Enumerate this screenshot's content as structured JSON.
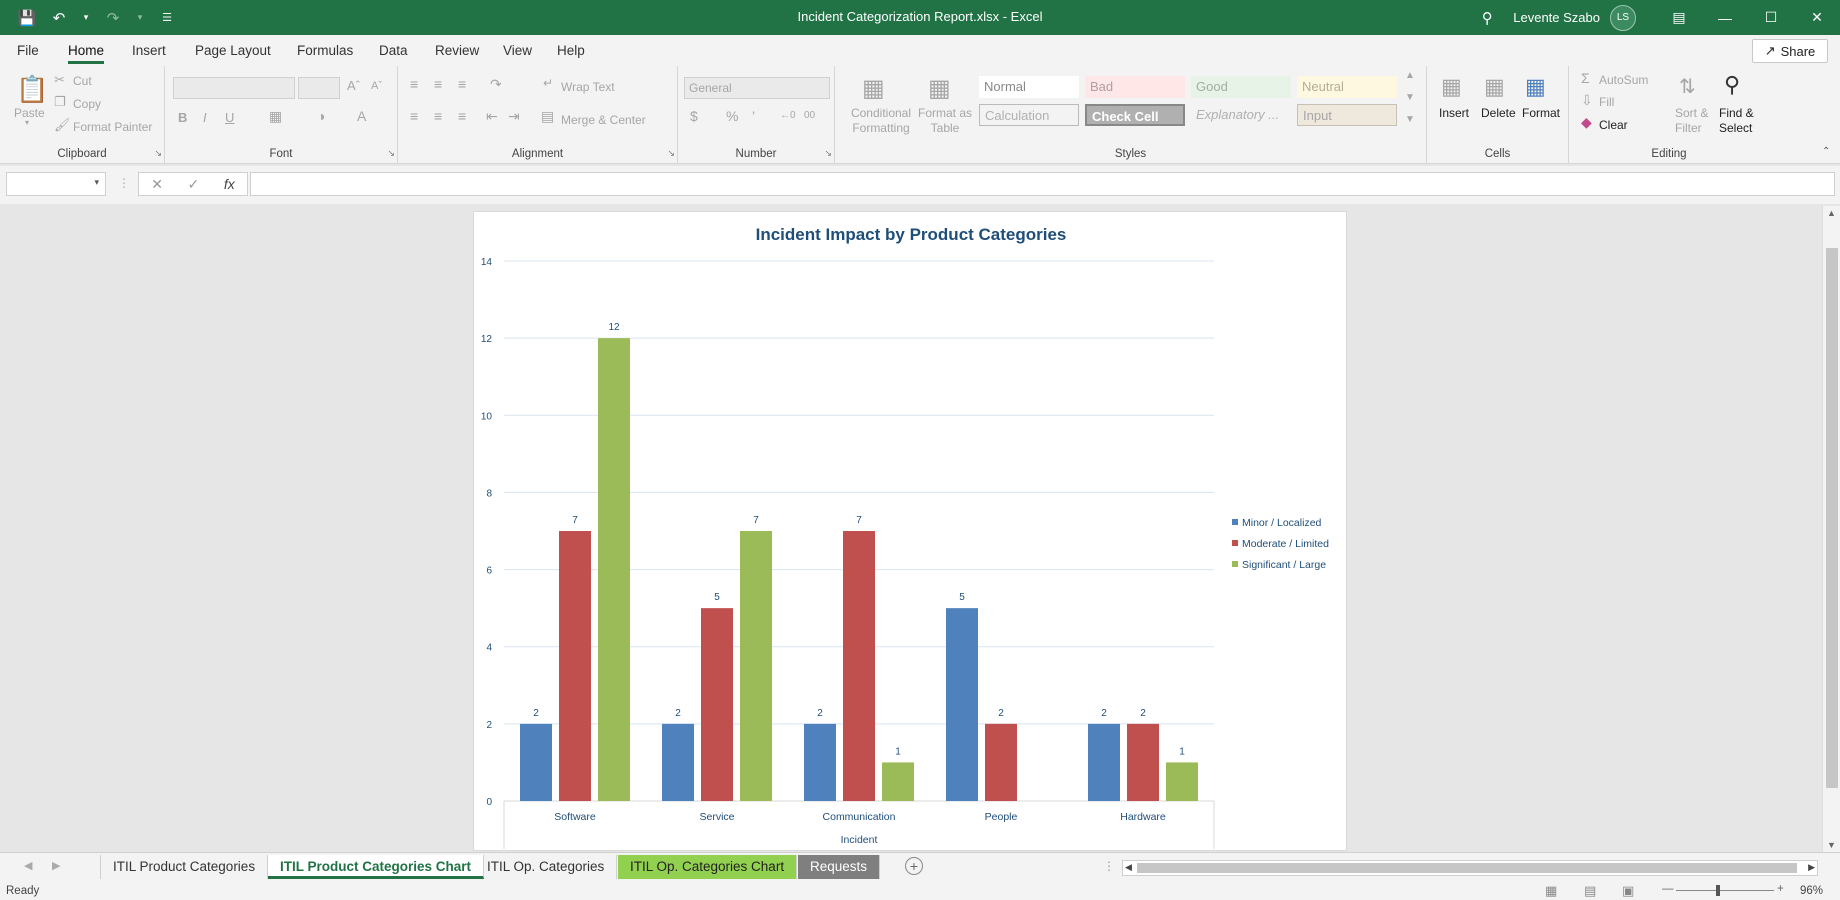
{
  "window": {
    "title": "Incident Categorization Report.xlsx  -  Excel",
    "user_name": "Levente Szabo",
    "user_initials": "LS"
  },
  "menu": {
    "items": [
      "File",
      "Home",
      "Insert",
      "Page Layout",
      "Formulas",
      "Data",
      "Review",
      "View",
      "Help"
    ],
    "active": "Home",
    "share_label": "Share"
  },
  "ribbon": {
    "clipboard": {
      "label": "Clipboard",
      "paste": "Paste",
      "cut": "Cut",
      "copy": "Copy",
      "format_painter": "Format Painter"
    },
    "font": {
      "label": "Font",
      "bold": "B",
      "italic": "I",
      "underline": "U"
    },
    "alignment": {
      "label": "Alignment",
      "wrap_text": "Wrap Text",
      "merge_center": "Merge & Center"
    },
    "number": {
      "label": "Number",
      "format_value": "General"
    },
    "styles": {
      "label": "Styles",
      "conditional": "Conditional Formatting",
      "format_table": "Format as Table",
      "cells": [
        "Normal",
        "Bad",
        "Good",
        "Neutral",
        "Calculation",
        "Check Cell",
        "Explanatory ...",
        "Input"
      ]
    },
    "cells_group": {
      "label": "Cells",
      "insert": "Insert",
      "delete": "Delete",
      "format": "Format"
    },
    "editing": {
      "label": "Editing",
      "autosum": "AutoSum",
      "fill": "Fill",
      "clear": "Clear",
      "sort_filter": "Sort & Filter",
      "find_select": "Find & Select"
    }
  },
  "chart_data": {
    "type": "bar",
    "title": "Incident Impact by Product Categories",
    "xlabel": "Incident",
    "ylabel": "",
    "ylim": [
      0,
      14
    ],
    "yticks": [
      0,
      2,
      4,
      6,
      8,
      10,
      12,
      14
    ],
    "categories": [
      "Software",
      "Service",
      "Communication",
      "People",
      "Hardware"
    ],
    "series": [
      {
        "name": "Minor / Localized",
        "color": "#4f81bd",
        "values": [
          2,
          2,
          2,
          5,
          2
        ]
      },
      {
        "name": "Moderate / Limited",
        "color": "#c0504d",
        "values": [
          7,
          5,
          7,
          2,
          2
        ]
      },
      {
        "name": "Significant / Large",
        "color": "#9bbb59",
        "values": [
          12,
          7,
          1,
          null,
          1
        ]
      }
    ],
    "grid": true,
    "legend": "right"
  },
  "sheet_tabs": [
    {
      "label": "ITIL Product Categories",
      "style": "normal"
    },
    {
      "label": "ITIL Product Categories Chart",
      "style": "active"
    },
    {
      "label": "ITIL Op. Categories",
      "style": "normal"
    },
    {
      "label": "ITIL Op. Categories Chart",
      "style": "green"
    },
    {
      "label": "Requests",
      "style": "grey"
    }
  ],
  "status": {
    "ready": "Ready",
    "zoom": "96%"
  }
}
